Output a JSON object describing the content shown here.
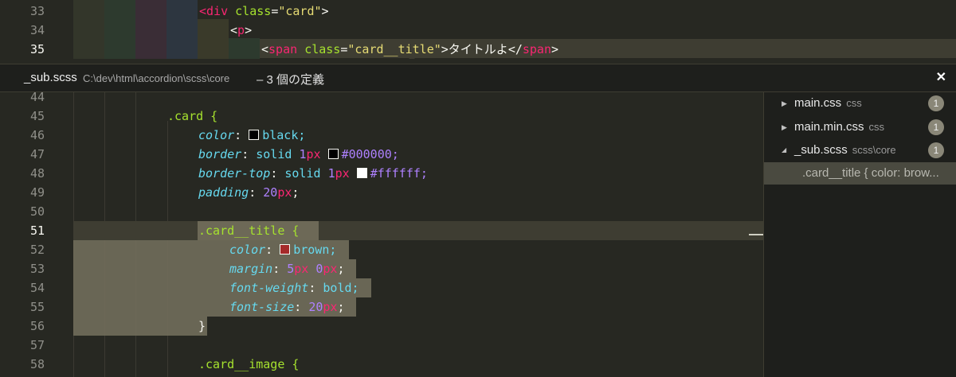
{
  "top_editor": {
    "lines": [
      {
        "num": "33",
        "parts": [
          [
            "tag",
            "<div "
          ],
          [
            "attr",
            "class"
          ],
          [
            "plain",
            "="
          ],
          [
            "str",
            "\"card\""
          ],
          [
            "plain",
            ">"
          ]
        ]
      },
      {
        "num": "34",
        "parts": [
          [
            "plain",
            "<"
          ],
          [
            "tag",
            "p"
          ],
          [
            "plain",
            ">"
          ]
        ]
      },
      {
        "num": "35",
        "parts": [
          [
            "plain",
            "<"
          ],
          [
            "tag",
            "span "
          ],
          [
            "attr",
            "class"
          ],
          [
            "plain",
            "="
          ],
          [
            "str",
            "\"card__title\""
          ],
          [
            "plain",
            ">タイトルよ</"
          ],
          [
            "tag",
            "span"
          ],
          [
            "plain",
            ">"
          ]
        ]
      }
    ]
  },
  "peek": {
    "filename": "_sub.scss",
    "path": "C:\\dev\\html\\accordion\\scss\\core",
    "summary": "– 3 個の定義",
    "close_glyph": "✕"
  },
  "peek_editor": {
    "lines": [
      {
        "num": "44"
      },
      {
        "num": "45"
      },
      {
        "num": "46"
      },
      {
        "num": "47"
      },
      {
        "num": "48"
      },
      {
        "num": "49"
      },
      {
        "num": "50"
      },
      {
        "num": "51"
      },
      {
        "num": "52"
      },
      {
        "num": "53"
      },
      {
        "num": "54"
      },
      {
        "num": "55"
      },
      {
        "num": "56"
      },
      {
        "num": "57"
      },
      {
        "num": "58"
      }
    ],
    "code": {
      "card_sel": ".card {",
      "color_prop": "color",
      "color_val": "black;",
      "border_prop": "border",
      "border_solid": "solid ",
      "border_num": "1",
      "border_unit": "px",
      "border_hex": "#000000;",
      "bt_prop": "border-top",
      "bt_solid": "solid ",
      "bt_num": "1",
      "bt_unit": "px",
      "bt_hex": "#ffffff;",
      "pad_prop": "padding",
      "pad_num": "20",
      "pad_unit": "px",
      "title_sel": ".card__title {",
      "t_color_prop": "color",
      "t_color_val": "brown;",
      "margin_prop": "margin",
      "margin_num1": "5",
      "margin_unit1": "px",
      "margin_num2": " 0",
      "margin_unit2": "px",
      "fw_prop": "font-weight",
      "fw_val": "bold;",
      "fs_prop": "font-size",
      "fs_num": "20",
      "fs_unit": "px",
      "close_brace": "}",
      "image_sel": ".card__image {"
    },
    "swatches": {
      "black": "#000000",
      "black2": "#000000",
      "white": "#ffffff",
      "brown": "#a52a2a"
    }
  },
  "references": [
    {
      "name": "main.css",
      "dir": "css",
      "count": "1",
      "expanded": false
    },
    {
      "name": "main.min.css",
      "dir": "css",
      "count": "1",
      "expanded": false
    },
    {
      "name": "_sub.scss",
      "dir": "scss\\core",
      "count": "1",
      "expanded": true
    }
  ],
  "selected_reference": ".card__title { color: brow..."
}
